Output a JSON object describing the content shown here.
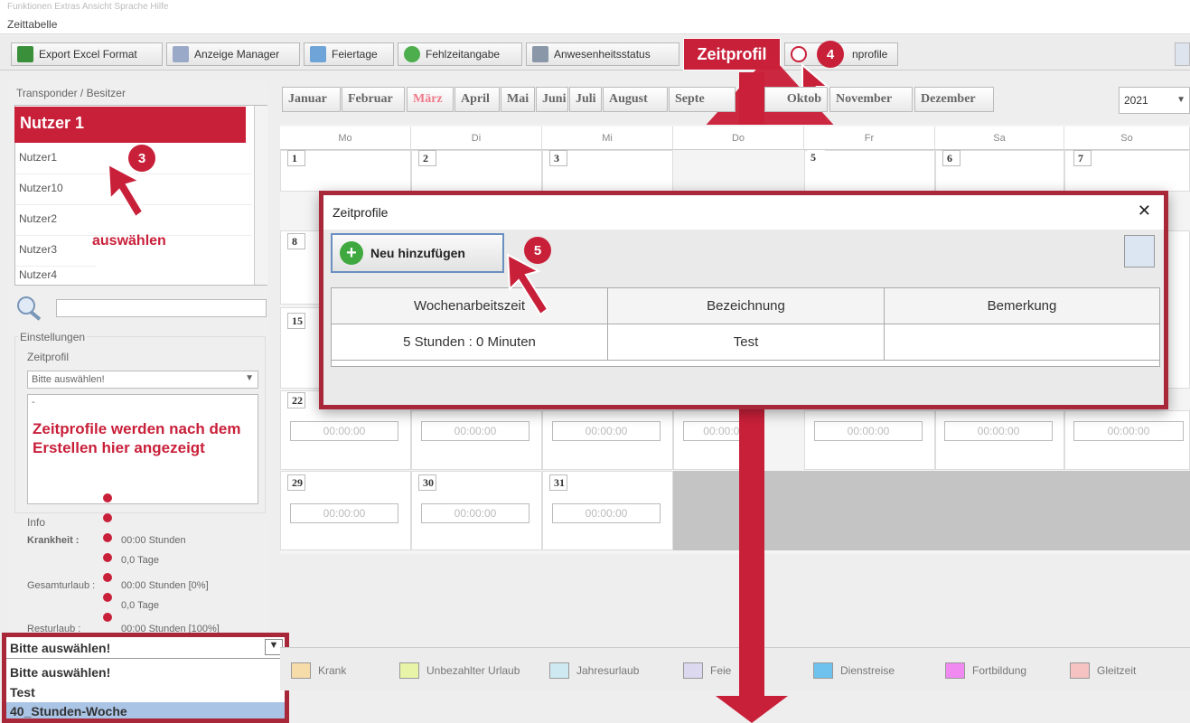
{
  "window": {
    "menu_faint": "Funktionen  Extras  Ansicht  Sprache  Hilfe",
    "title": "Zeittabelle"
  },
  "toolbar": {
    "export": "Export Excel Format",
    "anzeige": "Anzeige Manager",
    "feiertage": "Feiertage",
    "fehlzeit": "Fehlzeitangabe",
    "anwesenheit": "Anwesenheitsstatus",
    "zeitprofil": "Zeitprofil",
    "wochenprofile": "nprofile"
  },
  "badges": {
    "b3": "3",
    "b4": "4",
    "b5": "5"
  },
  "left": {
    "owner_label": "Transponder / Besitzer",
    "selected_user": "Nutzer 1",
    "users": [
      "Nutzer1",
      "Nutzer10",
      "Nutzer2",
      "Nutzer3",
      "Nutzer4"
    ],
    "select_hint": "auswählen",
    "settings_label": "Einstellungen",
    "profile_label": "Zeitprofil",
    "profile_select": "Bitte auswählen!",
    "profile_box_dash": "-",
    "profile_note": "Zeitprofile werden nach dem Erstellen hier angezeigt",
    "info_label": "Info",
    "krank_label": "Krankheit :",
    "krank_h": "00:00 Stunden",
    "krank_d": "0,0 Tage",
    "gesamt_label": "Gesamturlaub :",
    "gesamt_h": "00:00 Stunden [0%]",
    "gesamt_d": "0,0 Tage",
    "rest_label": "Resturlaub :",
    "rest_h": "00:00 Stunden [100%]"
  },
  "dropdown": {
    "current": "Bitte auswählen!",
    "options": [
      "Bitte auswählen!",
      "Test",
      "40_Stunden-Woche"
    ]
  },
  "months": [
    "Januar",
    "Februar",
    "März",
    "April",
    "Mai",
    "Juni",
    "Juli",
    "August",
    "Septe",
    "Oktob",
    "November",
    "Dezember"
  ],
  "active_month": "März",
  "year": "2021",
  "weekdays": [
    "Mo",
    "Di",
    "Mi",
    "Do",
    "Fr",
    "Sa",
    "So"
  ],
  "days": {
    "r1": [
      "1",
      "2",
      "3",
      "",
      "5",
      "6",
      "7"
    ],
    "r2": [
      "8"
    ],
    "r3": [
      "15"
    ],
    "r4": [
      "22"
    ],
    "r5": [
      "29",
      "30",
      "31"
    ]
  },
  "time_empty": "00:00:00",
  "legend": [
    "Krank",
    "Unbezahlter Urlaub",
    "Jahresurlaub",
    "Feie",
    "Dienstreise",
    "Fortbildung",
    "Gleitzeit"
  ],
  "legend_colors": [
    "#f6dca8",
    "#e8f4a8",
    "#cfe9f3",
    "#dcd8ef",
    "#6fc2ee",
    "#f08af0",
    "#f7c2c2"
  ],
  "dialog": {
    "title": "Zeitprofile",
    "close": "✕",
    "add_button": "Neu hinzufügen",
    "columns": [
      "Wochenarbeitszeit",
      "Bezeichnung",
      "Bemerkung"
    ],
    "rows": [
      [
        "5 Stunden : 0 Minuten",
        "Test",
        ""
      ]
    ]
  }
}
